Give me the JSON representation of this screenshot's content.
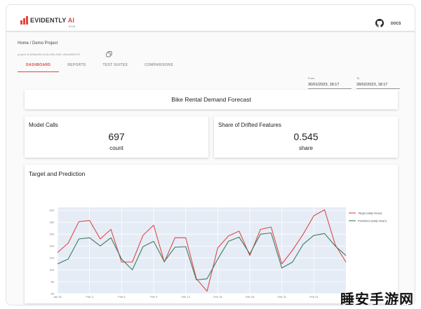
{
  "app": {
    "logo_text": "EVIDENTLY",
    "logo_ai": "AI",
    "version": "0.4.6",
    "docs_label": "DOCS"
  },
  "breadcrumb": "Home / Demo Project",
  "project_id": "project id 8e5ba5fd-cb0d-4f9d-9b87-e6da9f0f0c70",
  "tabs": [
    {
      "label": "DASHBOARD",
      "active": true
    },
    {
      "label": "REPORTS",
      "active": false
    },
    {
      "label": "TEST SUITES",
      "active": false
    },
    {
      "label": "COMPARISONS",
      "active": false
    }
  ],
  "date_from": {
    "label": "From",
    "value": "30/01/2023, 18:17"
  },
  "date_to": {
    "label": "To",
    "value": "28/02/2023, 18:17"
  },
  "dashboard_title": "Bike Rental Demand Forecast",
  "metrics": [
    {
      "title": "Model Calls",
      "value": "697",
      "unit": "count"
    },
    {
      "title": "Share of Drifted Features",
      "value": "0.545",
      "unit": "share"
    }
  ],
  "colors": {
    "accent": "#e2463c",
    "target_line": "#e04848",
    "prediction_line": "#3f7a5f",
    "plot_bg": "#e5ecf6"
  },
  "icons": {
    "github": "github-icon",
    "copy": "copy-icon"
  },
  "watermark": "睡安手游网",
  "chart_data": {
    "type": "line",
    "title": "Target and Prediction",
    "x": [
      "Jan 31",
      "Feb 1",
      "Feb 2",
      "Feb 3",
      "Feb 4",
      "Feb 5",
      "Feb 6",
      "Feb 7",
      "Feb 8",
      "Feb 9",
      "Feb 10",
      "Feb 11",
      "Feb 12",
      "Feb 13",
      "Feb 14",
      "Feb 15",
      "Feb 16",
      "Feb 17",
      "Feb 18",
      "Feb 19",
      "Feb 20",
      "Feb 21",
      "Feb 22",
      "Feb 23",
      "Feb 24",
      "Feb 25",
      "Feb 26",
      "Feb 27"
    ],
    "xticks": [
      "Jan 31",
      "Feb 3",
      "Feb 6",
      "Feb 9",
      "Feb 12",
      "Feb 15",
      "Feb 18",
      "Feb 21",
      "Feb 24"
    ],
    "yticks": [
      60,
      80,
      100,
      120,
      140,
      160,
      180,
      200
    ],
    "ylim": [
      60,
      205
    ],
    "series": [
      {
        "name": "Target (daily mean)",
        "values": [
          129,
          145,
          181,
          183,
          152,
          168,
          113,
          113,
          158,
          175,
          113,
          154,
          154,
          85,
          64,
          137,
          157,
          165,
          124,
          168,
          172,
          110,
          133,
          160,
          191,
          201,
          142,
          113
        ]
      },
      {
        "name": "Prediction (daily mean)",
        "values": [
          110,
          118,
          152,
          154,
          140,
          154,
          118,
          100,
          139,
          148,
          114,
          138,
          139,
          83,
          85,
          118,
          148,
          155,
          127,
          160,
          162,
          103,
          113,
          143,
          158,
          161,
          140,
          124
        ]
      }
    ],
    "legend_position": "top-right",
    "grid": true
  }
}
